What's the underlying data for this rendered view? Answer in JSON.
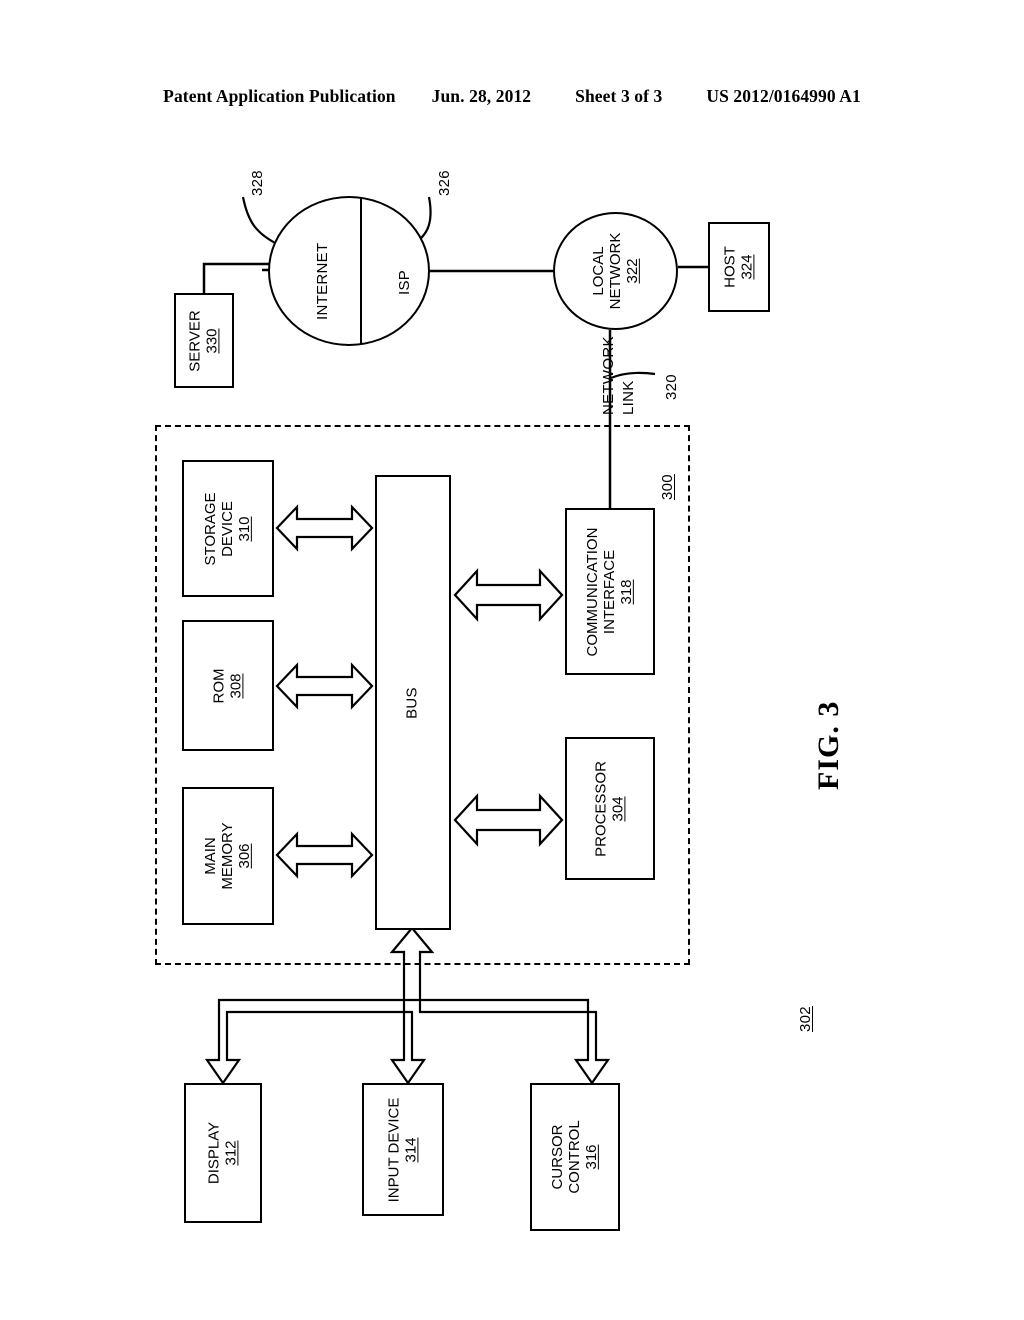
{
  "header": {
    "publication": "Patent Application Publication",
    "date": "Jun. 28, 2012",
    "sheet": "Sheet 3 of 3",
    "patent_number": "US 2012/0164990 A1"
  },
  "figure": {
    "label": "FIG. 3",
    "enclosure_ref": "300",
    "network_link_label_line1": "NETWORK",
    "network_link_label_line2": "LINK",
    "network_link_ref": "320",
    "internet_ref": "328",
    "isp_ref": "326"
  },
  "nodes": {
    "server": {
      "name": "SERVER",
      "ref": "330"
    },
    "internet": {
      "name": "INTERNET",
      "ref": ""
    },
    "isp": {
      "name": "ISP",
      "ref": ""
    },
    "local_network": {
      "name_line1": "LOCAL",
      "name_line2": "NETWORK",
      "ref": "322"
    },
    "host": {
      "name": "HOST",
      "ref": "324"
    },
    "storage": {
      "name_line1": "STORAGE",
      "name_line2": "DEVICE",
      "ref": "310"
    },
    "rom": {
      "name": "ROM",
      "ref": "308"
    },
    "main_memory": {
      "name_line1": "MAIN",
      "name_line2": "MEMORY",
      "ref": "306"
    },
    "bus": {
      "name": "BUS",
      "ref": "302"
    },
    "comm_interface": {
      "name_line1": "COMMUNICATION",
      "name_line2": "INTERFACE",
      "ref": "318"
    },
    "processor": {
      "name": "PROCESSOR",
      "ref": "304"
    },
    "display": {
      "name": "DISPLAY",
      "ref": "312"
    },
    "input_device": {
      "name": "INPUT DEVICE",
      "ref": "314"
    },
    "cursor_control": {
      "name_line1": "CURSOR",
      "name_line2": "CONTROL",
      "ref": "316"
    }
  },
  "chart_data": {
    "type": "diagram",
    "title": "FIG. 3",
    "orientation": "rotated-90-ccw",
    "blocks": [
      {
        "id": "330",
        "label": "SERVER",
        "shape": "rect"
      },
      {
        "id": "328",
        "label": "INTERNET",
        "shape": "circle-half"
      },
      {
        "id": "326",
        "label": "ISP",
        "shape": "circle-half"
      },
      {
        "id": "322",
        "label": "LOCAL NETWORK",
        "shape": "circle"
      },
      {
        "id": "324",
        "label": "HOST",
        "shape": "rect"
      },
      {
        "id": "320",
        "label": "NETWORK LINK",
        "shape": "line-label"
      },
      {
        "id": "300",
        "label": "computer system boundary",
        "shape": "dashed-rect"
      },
      {
        "id": "310",
        "label": "STORAGE DEVICE",
        "shape": "rect"
      },
      {
        "id": "308",
        "label": "ROM",
        "shape": "rect"
      },
      {
        "id": "306",
        "label": "MAIN MEMORY",
        "shape": "rect"
      },
      {
        "id": "302",
        "label": "BUS",
        "shape": "rect"
      },
      {
        "id": "318",
        "label": "COMMUNICATION INTERFACE",
        "shape": "rect"
      },
      {
        "id": "304",
        "label": "PROCESSOR",
        "shape": "rect"
      },
      {
        "id": "312",
        "label": "DISPLAY",
        "shape": "rect"
      },
      {
        "id": "314",
        "label": "INPUT DEVICE",
        "shape": "rect"
      },
      {
        "id": "316",
        "label": "CURSOR CONTROL",
        "shape": "rect"
      }
    ],
    "connections": [
      {
        "from": "330",
        "to": "328",
        "style": "plain"
      },
      {
        "from": "326",
        "to": "322",
        "style": "plain"
      },
      {
        "from": "322",
        "to": "324",
        "style": "plain"
      },
      {
        "from": "322",
        "to": "318",
        "style": "plain",
        "label": "NETWORK LINK 320"
      },
      {
        "from": "310",
        "to": "302",
        "style": "double-arrow"
      },
      {
        "from": "308",
        "to": "302",
        "style": "double-arrow"
      },
      {
        "from": "306",
        "to": "302",
        "style": "double-arrow"
      },
      {
        "from": "302",
        "to": "318",
        "style": "double-arrow"
      },
      {
        "from": "302",
        "to": "304",
        "style": "double-arrow"
      },
      {
        "from": "302",
        "to": "312",
        "style": "arrow"
      },
      {
        "from": "302",
        "to": "314",
        "style": "arrow"
      },
      {
        "from": "302",
        "to": "316",
        "style": "arrow"
      }
    ]
  }
}
